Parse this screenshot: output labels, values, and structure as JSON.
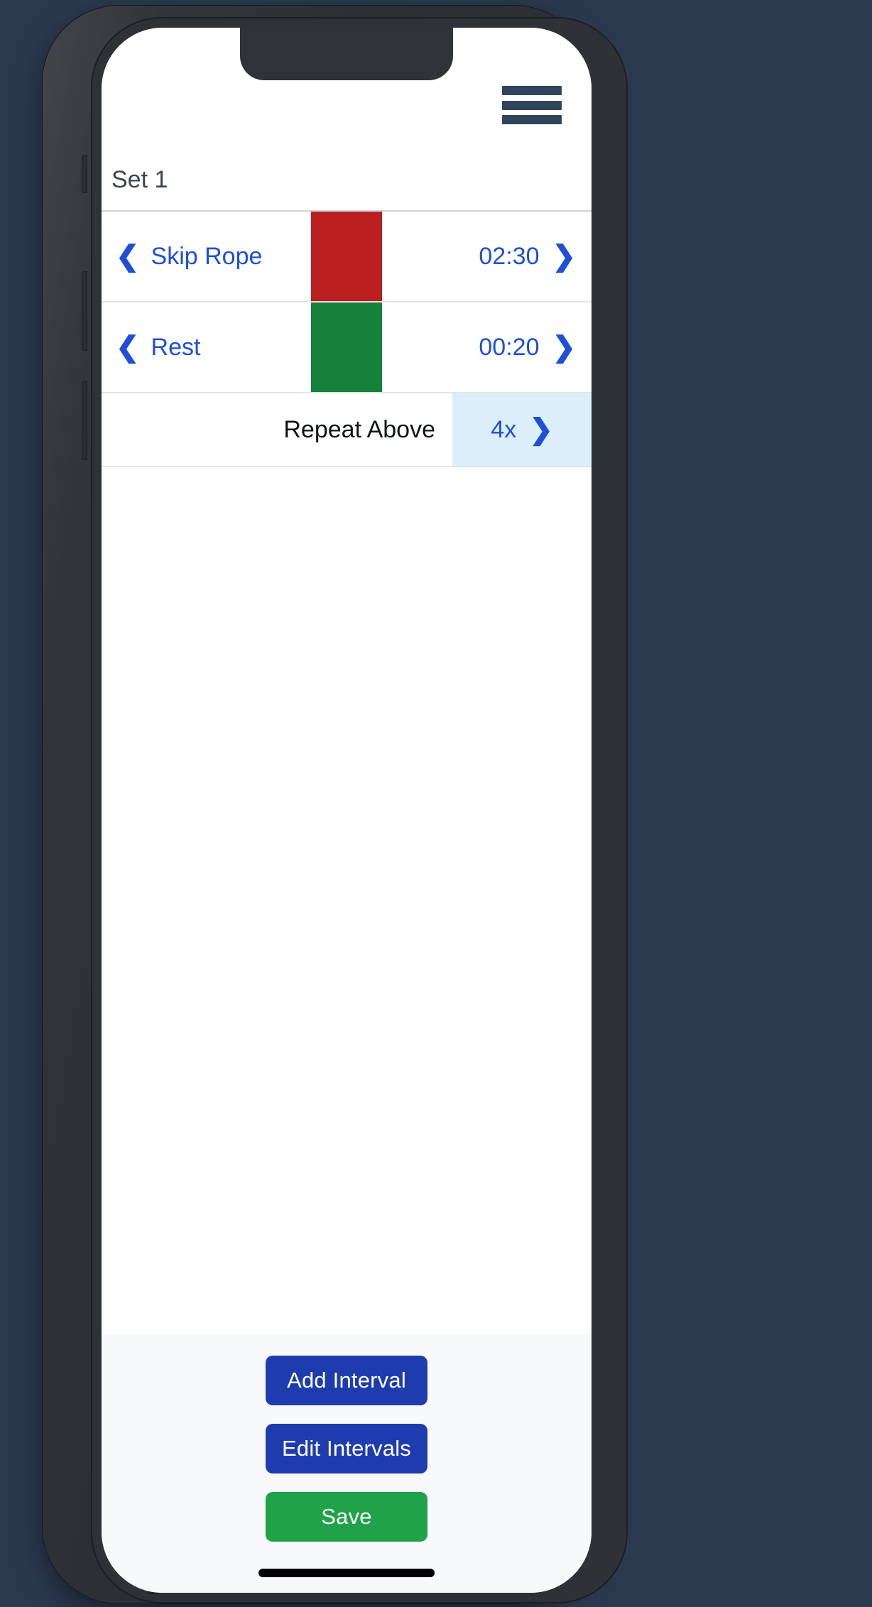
{
  "theme": {
    "page_background": "#2b394f",
    "accent_blue": "#1f4fd8",
    "button_blue": "#1f3cae",
    "button_green": "#1fa249",
    "highlight_cell": "#ddeefb",
    "footer_background": "#f7f9fb",
    "hamburger_color": "#30455c"
  },
  "topbar": {
    "menu_icon": "hamburger-menu-icon"
  },
  "set": {
    "title": "Set 1"
  },
  "intervals": [
    {
      "prev_icon": "chevron-left-icon",
      "name": "Skip Rope",
      "duration": "02:30",
      "next_icon": "chevron-right-icon",
      "color": "#b9201f",
      "bar_height_pct": 100
    },
    {
      "prev_icon": "chevron-left-icon",
      "name": "Rest",
      "duration": "00:20",
      "next_icon": "chevron-right-icon",
      "color": "#15813a",
      "bar_height_pct": 100
    }
  ],
  "repeat": {
    "label": "Repeat Above",
    "count": "4x",
    "next_icon": "chevron-right-icon"
  },
  "footer": {
    "add_interval_label": "Add Interval",
    "edit_intervals_label": "Edit Intervals",
    "save_label": "Save"
  }
}
